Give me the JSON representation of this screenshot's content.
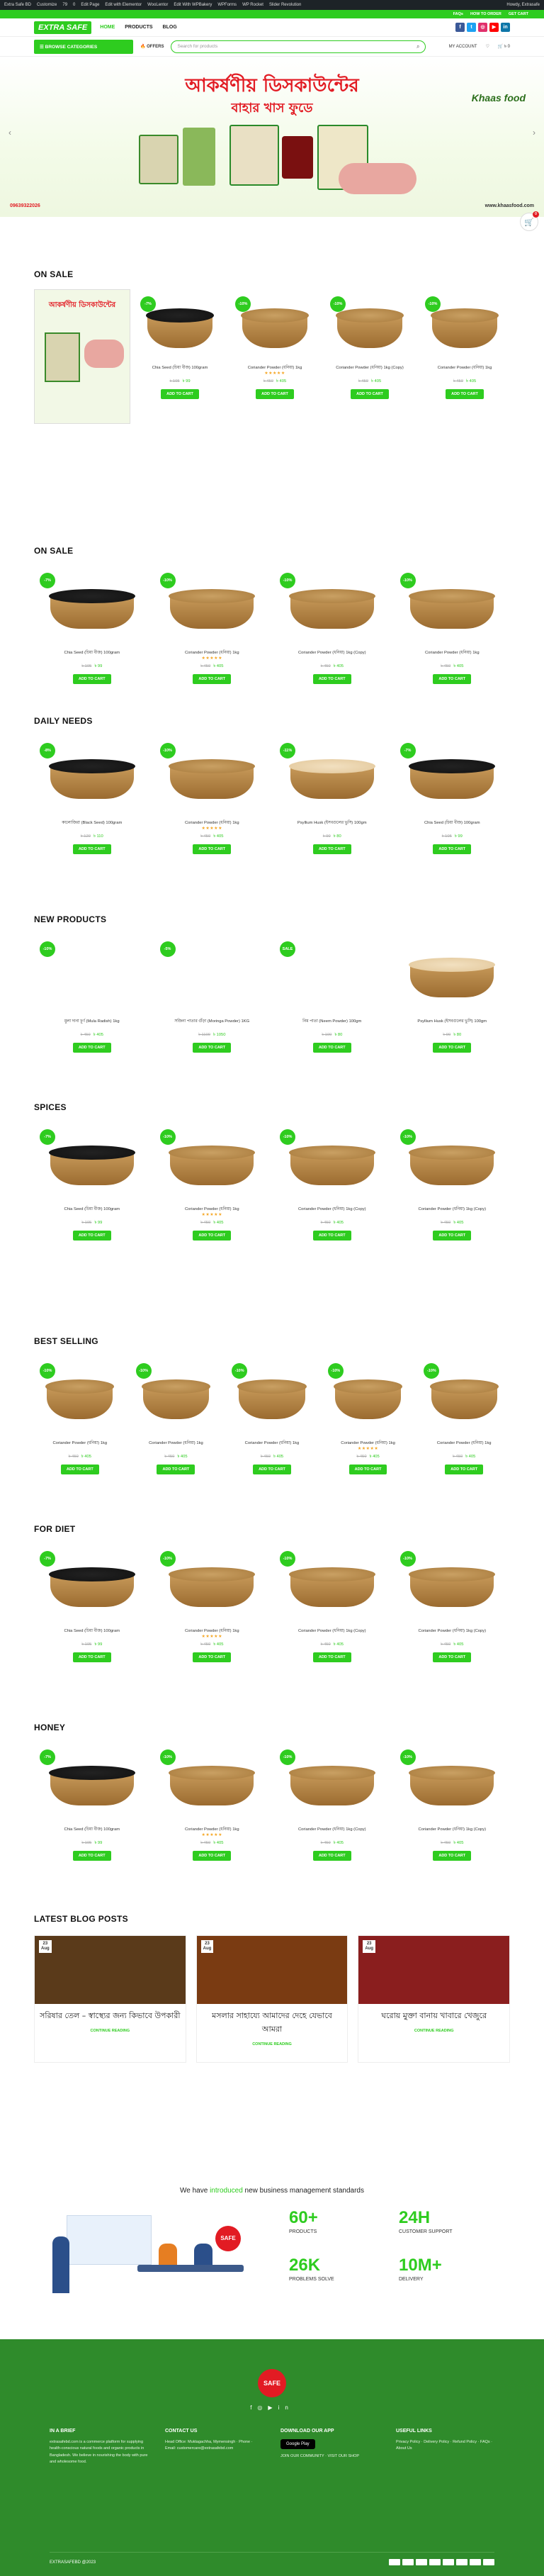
{
  "wpbar": [
    "Extra Safe BD",
    "Customize",
    "79",
    "0",
    "Edit Page",
    "Edit with Elementor",
    "WooLentor",
    "Edit With WPBakery",
    "WPForms",
    "WP Rocket",
    "Slider Revolution"
  ],
  "wpbar_greet": "Howdy, Extrasafe",
  "topstrip": [
    "FAQs",
    "HOW TO ORDER",
    "GET CART"
  ],
  "logo": "EXTRA SAFE",
  "nav": [
    "HOME",
    "PRODUCTS",
    "BLOG"
  ],
  "social_colors": [
    "#3b5998",
    "#1da1f2",
    "#e1306c",
    "#ff0000",
    "#0e76a8"
  ],
  "categories_label": "BROWSE CATEGORIES",
  "offers_label": "OFFERS",
  "search_placeholder": "Search for products",
  "account_label": "MY ACCOUNT",
  "cart_total": "৳ 0",
  "cart_count": "0",
  "hero": {
    "line1": "আকর্ষণীয় ডিসকাউন্টের",
    "line2": "বাহার খাস ফুডে",
    "brand": "Khaas food",
    "phone": "09639322026",
    "web": "www.khaasfood.com"
  },
  "sections": [
    {
      "title": "ON SALE",
      "promo": "আকর্ষণীয় ডিসকাউন্টের",
      "products": [
        {
          "badge": "-7%",
          "name": "Chia Seed (চিয়া বীজ) 100gram",
          "old": "৳ 105",
          "price": "৳ 99",
          "stars": false,
          "bowl": "black",
          "cta": "ADD TO CART"
        },
        {
          "badge": "-10%",
          "name": "Coriander Powder (ধনিয়া) 1kg",
          "old": "৳ 450",
          "price": "৳ 405",
          "stars": true,
          "bowl": "brown",
          "cta": "ADD TO CART"
        },
        {
          "badge": "-10%",
          "name": "Coriander Powder (ধনিয়া) 1kg (Copy)",
          "old": "৳ 450",
          "price": "৳ 405",
          "stars": false,
          "bowl": "brown",
          "cta": "ADD TO CART"
        },
        {
          "badge": "-10%",
          "name": "Coriander Powder (ধনিয়া) 1kg",
          "old": "৳ 450",
          "price": "৳ 405",
          "stars": false,
          "bowl": "brown",
          "cta": "ADD TO CART"
        }
      ]
    },
    {
      "title": "ON SALE",
      "products": [
        {
          "badge": "-7%",
          "name": "Chia Seed (চিয়া বীজ) 100gram",
          "old": "৳ 105",
          "price": "৳ 99",
          "stars": false,
          "bowl": "black",
          "cta": "ADD TO CART"
        },
        {
          "badge": "-10%",
          "name": "Coriander Powder (ধনিয়া) 1kg",
          "old": "৳ 450",
          "price": "৳ 405",
          "stars": true,
          "bowl": "brown",
          "cta": "ADD TO CART"
        },
        {
          "badge": "-10%",
          "name": "Coriander Powder (ধনিয়া) 1kg (Copy)",
          "old": "৳ 450",
          "price": "৳ 405",
          "stars": false,
          "bowl": "brown",
          "cta": "ADD TO CART"
        },
        {
          "badge": "-10%",
          "name": "Coriander Powder (ধনিয়া) 1kg",
          "old": "৳ 450",
          "price": "৳ 405",
          "stars": false,
          "bowl": "brown",
          "cta": "ADD TO CART"
        }
      ]
    },
    {
      "title": "DAILY NEEDS",
      "products": [
        {
          "badge": "-8%",
          "name": "কালোজিরা (Black Seed) 100gram",
          "old": "৳ 120",
          "price": "৳ 110",
          "stars": false,
          "bowl": "black",
          "cta": "ADD TO CART"
        },
        {
          "badge": "-10%",
          "name": "Coriander Powder (ধনিয়া) 1kg",
          "old": "৳ 450",
          "price": "৳ 405",
          "stars": true,
          "bowl": "brown",
          "cta": "ADD TO CART"
        },
        {
          "badge": "-11%",
          "name": "Psyllium Husk (ইসবগুলের ভুসি) 100gm",
          "old": "৳ 90",
          "price": "৳ 80",
          "stars": false,
          "bowl": "light",
          "cta": "ADD TO CART"
        },
        {
          "badge": "-7%",
          "name": "Chia Seed (চিয়া বীজ) 100gram",
          "old": "৳ 105",
          "price": "৳ 99",
          "stars": false,
          "bowl": "black",
          "cta": "ADD TO CART"
        }
      ]
    },
    {
      "title": "NEW PRODUCTS",
      "products": [
        {
          "badge": "-10%",
          "name": "মুলা দানা চূর্ণ (Mula Radish) 1kg",
          "old": "৳ 450",
          "price": "৳ 405",
          "stars": false,
          "bowl": "none",
          "cta": "ADD TO CART"
        },
        {
          "badge": "-5%",
          "name": "সজিনা পাতার গুঁড়া (Moringa Powder) 1KG",
          "old": "৳ 1100",
          "price": "৳ 1050",
          "stars": false,
          "bowl": "none",
          "cta": "ADD TO CART"
        },
        {
          "badge": "SALE",
          "name": "নিম পাতা (Neem Powder) 100gm",
          "old": "৳ 100",
          "price": "৳ 80",
          "stars": false,
          "bowl": "none",
          "cta": "ADD TO CART"
        },
        {
          "badge": "",
          "name": "Psyllium Husk (ইসবগুলের ভুসি) 100gm",
          "old": "৳ 90",
          "price": "৳ 80",
          "stars": false,
          "bowl": "light",
          "cta": "ADD TO CART"
        }
      ]
    },
    {
      "title": "SPICES",
      "products": [
        {
          "badge": "-7%",
          "name": "Chia Seed (চিয়া বীজ) 100gram",
          "old": "৳ 105",
          "price": "৳ 99",
          "stars": false,
          "bowl": "black",
          "cta": "ADD TO CART"
        },
        {
          "badge": "-10%",
          "name": "Coriander Powder (ধনিয়া) 1kg",
          "old": "৳ 450",
          "price": "৳ 405",
          "stars": true,
          "bowl": "brown",
          "cta": "ADD TO CART"
        },
        {
          "badge": "-10%",
          "name": "Coriander Powder (ধনিয়া) 1kg (Copy)",
          "old": "৳ 450",
          "price": "৳ 405",
          "stars": false,
          "bowl": "brown",
          "cta": "ADD TO CART"
        },
        {
          "badge": "-10%",
          "name": "Coriander Powder (ধনিয়া) 1kg (Copy)",
          "old": "৳ 450",
          "price": "৳ 405",
          "stars": false,
          "bowl": "brown",
          "cta": "ADD TO CART"
        }
      ]
    },
    {
      "title": "BEST SELLING",
      "products": [
        {
          "badge": "-10%",
          "name": "Coriander Powder (ধনিয়া) 1kg",
          "old": "৳ 450",
          "price": "৳ 405",
          "stars": false,
          "bowl": "brown",
          "cta": "ADD TO CART"
        },
        {
          "badge": "-10%",
          "name": "Coriander Powder (ধনিয়া) 1kg",
          "old": "৳ 450",
          "price": "৳ 405",
          "stars": false,
          "bowl": "brown",
          "cta": "ADD TO CART"
        },
        {
          "badge": "-10%",
          "name": "Coriander Powder (ধনিয়া) 1kg",
          "old": "৳ 450",
          "price": "৳ 405",
          "stars": false,
          "bowl": "brown",
          "cta": "ADD TO CART"
        },
        {
          "badge": "-10%",
          "name": "Coriander Powder (ধনিয়া) 1kg",
          "old": "৳ 450",
          "price": "৳ 405",
          "stars": true,
          "bowl": "brown",
          "cta": "ADD TO CART"
        },
        {
          "badge": "-10%",
          "name": "Coriander Powder (ধনিয়া) 1kg",
          "old": "৳ 450",
          "price": "৳ 405",
          "stars": false,
          "bowl": "brown",
          "cta": "ADD TO CART"
        }
      ]
    },
    {
      "title": "FOR DIET",
      "products": [
        {
          "badge": "-7%",
          "name": "Chia Seed (চিয়া বীজ) 100gram",
          "old": "৳ 105",
          "price": "৳ 99",
          "stars": false,
          "bowl": "black",
          "cta": "ADD TO CART"
        },
        {
          "badge": "-10%",
          "name": "Coriander Powder (ধনিয়া) 1kg",
          "old": "৳ 450",
          "price": "৳ 405",
          "stars": true,
          "bowl": "brown",
          "cta": "ADD TO CART"
        },
        {
          "badge": "-10%",
          "name": "Coriander Powder (ধনিয়া) 1kg (Copy)",
          "old": "৳ 450",
          "price": "৳ 405",
          "stars": false,
          "bowl": "brown",
          "cta": "ADD TO CART"
        },
        {
          "badge": "-10%",
          "name": "Coriander Powder (ধনিয়া) 1kg (Copy)",
          "old": "৳ 450",
          "price": "৳ 405",
          "stars": false,
          "bowl": "brown",
          "cta": "ADD TO CART"
        }
      ]
    },
    {
      "title": "HONEY",
      "products": [
        {
          "badge": "-7%",
          "name": "Chia Seed (চিয়া বীজ) 100gram",
          "old": "৳ 105",
          "price": "৳ 99",
          "stars": false,
          "bowl": "black",
          "cta": "ADD TO CART"
        },
        {
          "badge": "-10%",
          "name": "Coriander Powder (ধনিয়া) 1kg",
          "old": "৳ 450",
          "price": "৳ 405",
          "stars": true,
          "bowl": "brown",
          "cta": "ADD TO CART"
        },
        {
          "badge": "-10%",
          "name": "Coriander Powder (ধনিয়া) 1kg (Copy)",
          "old": "৳ 450",
          "price": "৳ 405",
          "stars": false,
          "bowl": "brown",
          "cta": "ADD TO CART"
        },
        {
          "badge": "-10%",
          "name": "Coriander Powder (ধনিয়া) 1kg (Copy)",
          "old": "৳ 450",
          "price": "৳ 405",
          "stars": false,
          "bowl": "brown",
          "cta": "ADD TO CART"
        }
      ]
    }
  ],
  "blog": {
    "title": "LATEST BLOG POSTS",
    "posts": [
      {
        "day": "23",
        "month": "Aug",
        "title": "সরিষার তেল – স্বাস্থ্যের জন্য কিভাবে উপকারী",
        "more": "CONTINUE READING",
        "bg": "#5a3a1a"
      },
      {
        "day": "23",
        "month": "Aug",
        "title": "মসলার সাহায্যে আমাদের দেহে যেভাবে আমরা",
        "more": "CONTINUE READING",
        "bg": "#7a3b12"
      },
      {
        "day": "23",
        "month": "Aug",
        "title": "ঘরোয় মুক্তা বানায় খাবারে খেজুরে",
        "more": "CONTINUE READING",
        "bg": "#8a1e1e"
      }
    ]
  },
  "stats": {
    "pre": "We have ",
    "em": "introduced",
    "post": " new business management standards",
    "items": [
      {
        "value": "60+",
        "label": "PRODUCTS"
      },
      {
        "value": "24H",
        "label": "CUSTOMER SUPPORT"
      },
      {
        "value": "26K",
        "label": "PROBLEMS SOLVE"
      },
      {
        "value": "10M+",
        "label": "DELIVERY"
      }
    ]
  },
  "footer": {
    "logo": "SAFE",
    "cols": [
      {
        "title": "IN A BRIEF",
        "text": "extrasafebd.com is a commerce platform for supplying health-conscious natural foods and organic products in Bangladesh. We believe in nourishing the body with pure and wholesome food."
      },
      {
        "title": "CONTACT US",
        "text": "Head Office: Muktagachha, Mymensingh · Phone · Email: customercare@extrasafebd.com"
      },
      {
        "title": "DOWNLOAD OUR APP",
        "text": "JOIN OUR COMMUNITY · VISIT OUR SHOP"
      },
      {
        "title": "USEFUL LINKS",
        "text": "Privacy Policy · Delivery Policy · Refund Policy · FAQs · About Us"
      }
    ],
    "store": "Google Play",
    "copyright": "EXTRASAFEBD @2023"
  }
}
